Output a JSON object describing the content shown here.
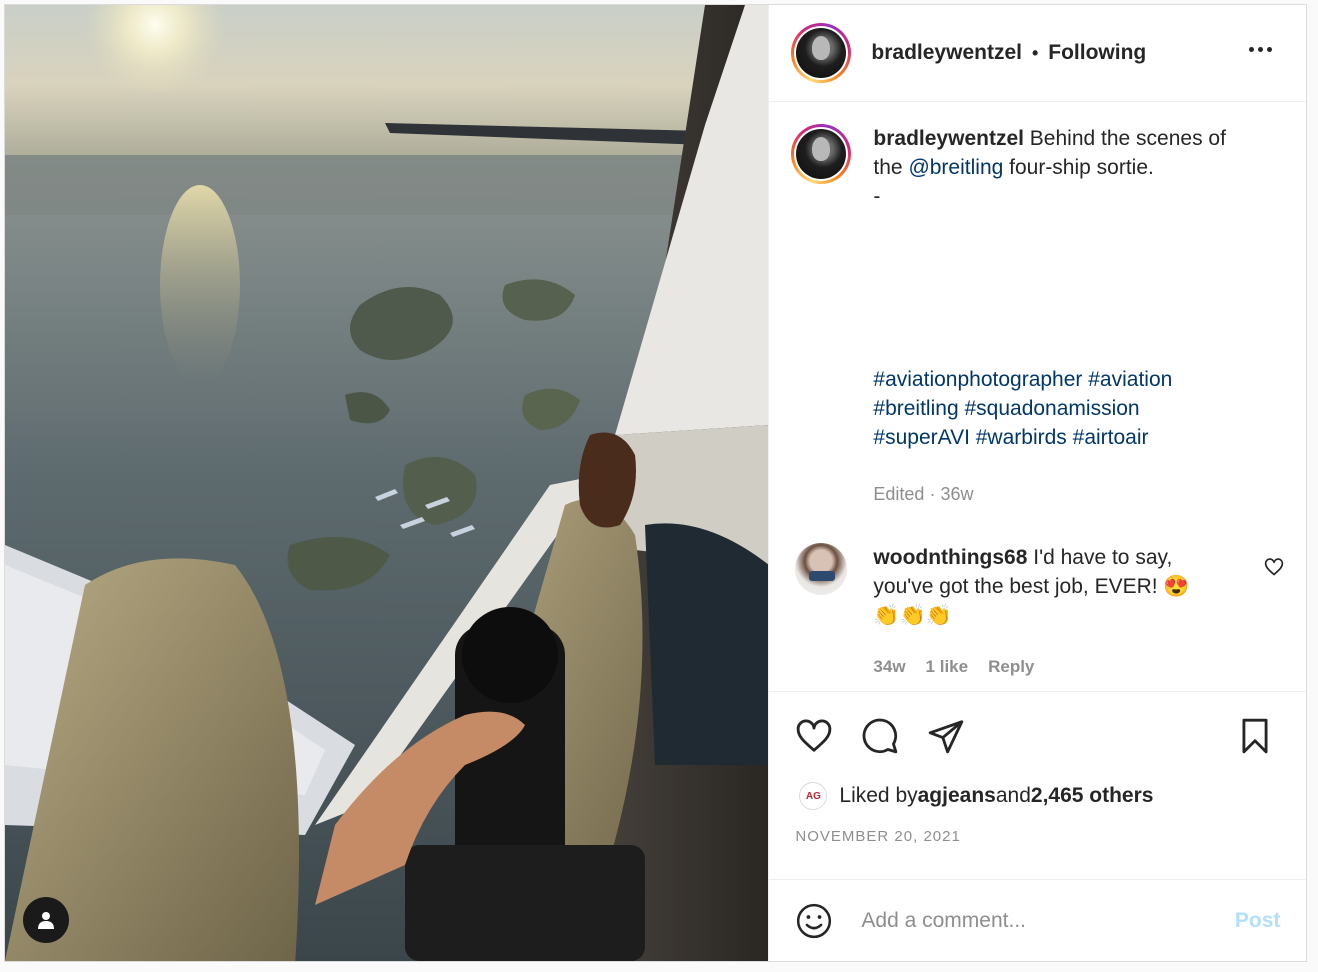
{
  "header": {
    "username": "bradleywentzel",
    "separator": "•",
    "follow_status": "Following"
  },
  "caption": {
    "username": "bradleywentzel",
    "text_before": " Behind the scenes of the ",
    "mention": "@breitling",
    "text_after": " four-ship sortie.",
    "dash": "-",
    "braille_lines": [
      "⠀⠀⠀⠀⠀⠀⠀⠀⠀⠀⠀⠀⠀⠀⠀⠀⠀⠀⠀ ⠀⠀⠀⠀⠀⠀⠀⠀⠀⠀⠀⠀⠀⠀⠀⠀⠀⠀⠀",
      "⠀⠀⠀⠀⠀⠀⠀⠀⠀⠀⠀⠀⠀⠀⠀⠀⠀⠀⠀ ⠀⠀⠀⠀⠀⠀⠀⠀⠀⠀⠀⠀⠀⠀⠀⠀⠀⠀⠀",
      "⠀⠀⠀⠀⠀⠀⠀⠀⠀⠀⠀⠀⠀⠀⠀⠀⠀⠀⠀ ⠀⠀⠀⠀⠀⠀⠀⠀⠀⠀⠀⠀⠀⠀⠀⠀⠀⠀⠀",
      "⠀⠀⠀⠀⠀⠀⠀⠀⠀⠀⠀⠀⠀⠀⠀⠀⠀⠀⠀ ⠀⠀⠀⠀⠀⠀⠀⠀⠀⠀⠀⠀⠀⠀⠀⠀⠀⠀⠀"
    ],
    "hashtag_lines": [
      [
        "#aviationphotographer",
        "#aviation"
      ],
      [
        "#breitling",
        "#squadonamission"
      ],
      [
        "#superAVI",
        "#warbirds",
        "#airtoair"
      ]
    ],
    "edited": "Edited · 36w"
  },
  "comment": {
    "username": "woodnthings68",
    "text": " I'd have to say, you've got the best job, EVER! 😍",
    "emoji_line": "👏👏👏",
    "age": "34w",
    "likes": "1 like",
    "reply": "Reply"
  },
  "likes": {
    "badge": "AG",
    "prefix": "Liked by ",
    "user": "agjeans",
    "middle": " and ",
    "others": "2,465 others"
  },
  "date": "NOVEMBER 20, 2021",
  "comment_box": {
    "placeholder": "Add a comment...",
    "post_label": "Post"
  },
  "icons": {
    "more": "more-options-icon",
    "like": "heart-icon",
    "comment": "comment-bubble-icon",
    "share": "paper-plane-icon",
    "save": "bookmark-icon",
    "emoji": "smiley-icon",
    "user_tags": "person-icon"
  },
  "colors": {
    "link": "#00376b",
    "muted": "#8e8e8e",
    "post_disabled": "#b2dffc"
  }
}
